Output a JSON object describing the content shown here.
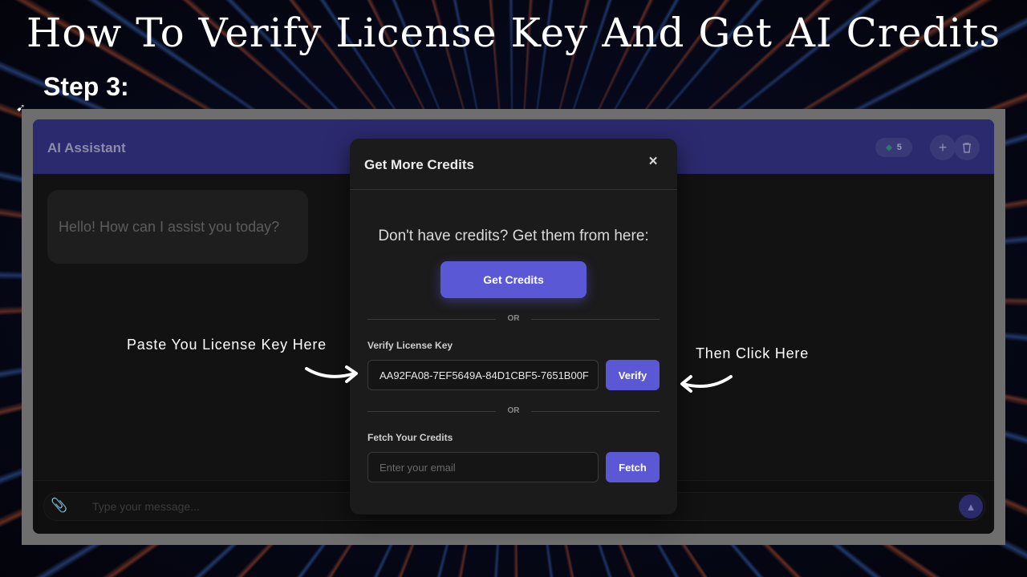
{
  "headline": "How To Verify License Key And Get AI Credits",
  "step_label": "Step 3:",
  "app": {
    "title": "AI Assistant",
    "credits_count": "5",
    "header_icons": [
      "gem-icon",
      "plus-icon",
      "trash-icon"
    ],
    "greeting": "Hello! How can I assist you today?",
    "composer_placeholder": "Type your message..."
  },
  "modal": {
    "title": "Get More Credits",
    "close_glyph": "×",
    "prompt": "Don't have credits? Get them from here:",
    "get_credits_label": "Get Credits",
    "or_text": "OR",
    "verify_section_label": "Verify License Key",
    "license_key_value": "AA92FA08-7EF5649A-84D1CBF5-7651B00F",
    "verify_label": "Verify",
    "fetch_section_label": "Fetch Your Credits",
    "email_placeholder": "Enter your email",
    "fetch_label": "Fetch"
  },
  "annotations": {
    "paste_hint": "Paste You License Key Here",
    "click_hint": "Then Click Here"
  },
  "colors": {
    "accent": "#5b58d6",
    "header_bg": "#2c2a6f",
    "modal_bg": "#1b1b1b"
  }
}
